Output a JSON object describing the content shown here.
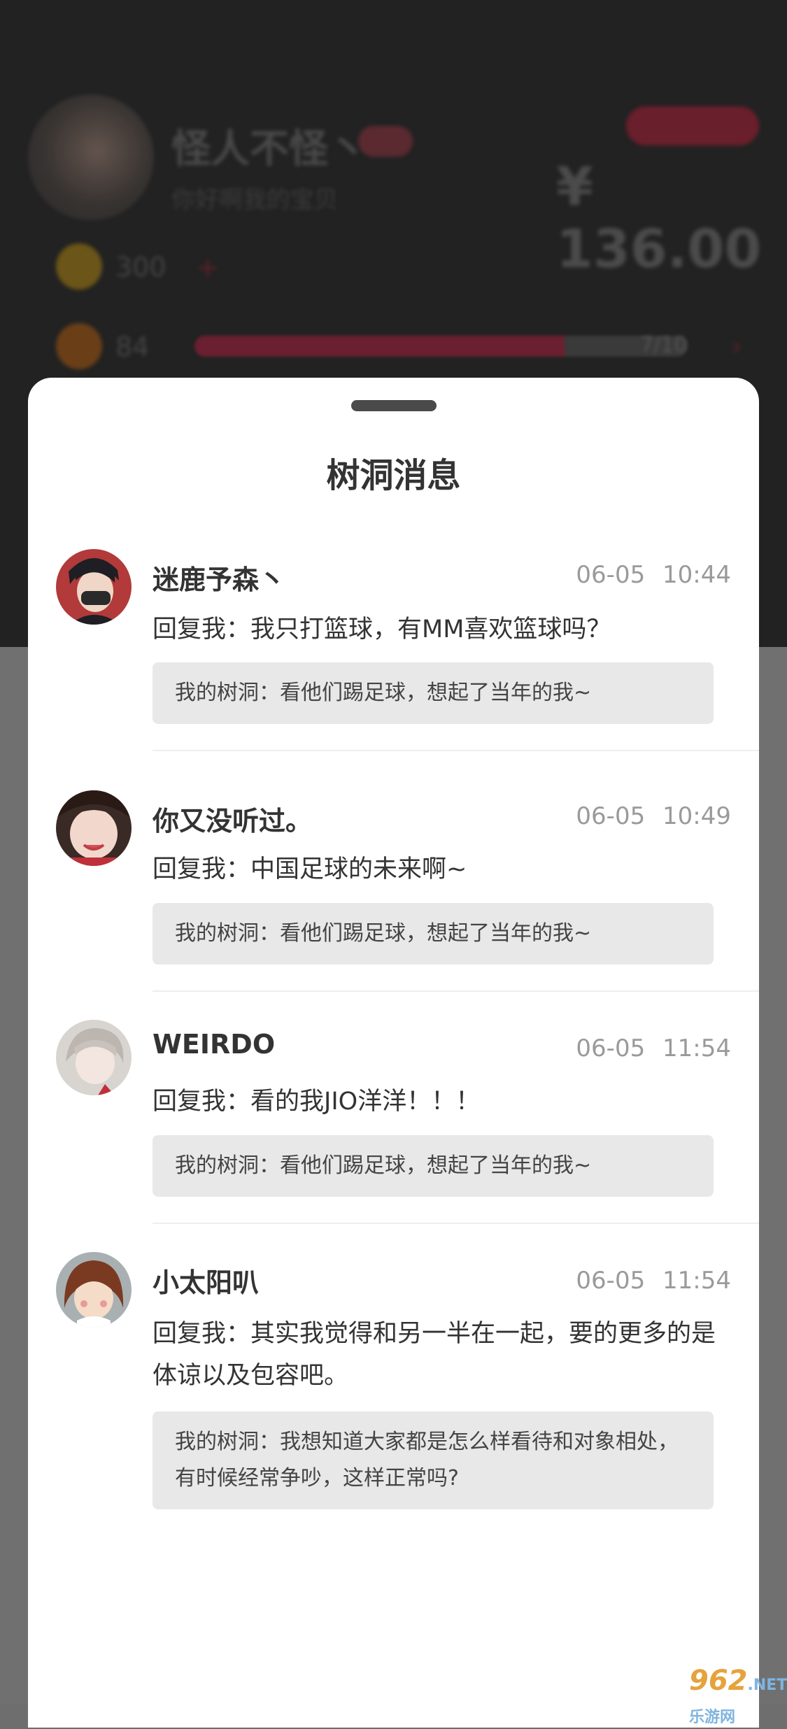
{
  "background": {
    "username": "怪人不怪丶",
    "subtitle": "你好啊我的宝贝",
    "balance": "¥ 136.00",
    "coins": "300",
    "plus": "+",
    "fruit_count": "84",
    "progress_text": "7/10",
    "progress": 0.75,
    "arrow": "›"
  },
  "sheet": {
    "title": "树洞消息"
  },
  "messages": [
    {
      "username": "迷鹿予森丶",
      "time": "06-05 10:44",
      "reply": "回复我：我只打篮球，有MM喜欢篮球吗？",
      "quote": "我的树洞：看他们踢足球，想起了当年的我~"
    },
    {
      "username": "你又没听过。",
      "time": "06-05 10:49",
      "reply": "回复我：中国足球的未来啊~",
      "quote": "我的树洞：看他们踢足球，想起了当年的我~"
    },
    {
      "username": "WEIRDO",
      "time": "06-05 11:54",
      "reply": "回复我：看的我JIO洋洋！！！",
      "quote": "我的树洞：看他们踢足球，想起了当年的我~"
    },
    {
      "username": "小太阳叭",
      "time": "06-05 11:54",
      "reply": "回复我：其实我觉得和另一半在一起，要的更多的是体谅以及包容吧。",
      "quote": "我的树洞：我想知道大家都是怎么样看待和对象相处，有时候经常争吵，这样正常吗?"
    }
  ],
  "watermark": {
    "brand": "962",
    "suffix": ".NET",
    "sub": "乐游网"
  }
}
